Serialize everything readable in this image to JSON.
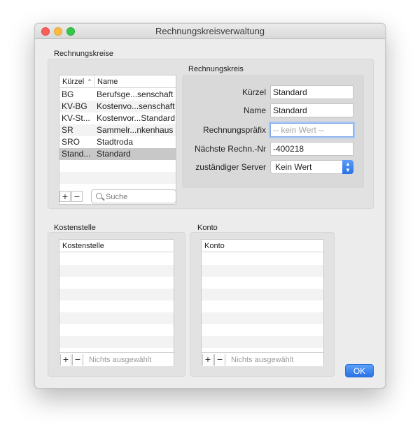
{
  "window": {
    "title": "Rechnungskreisverwaltung"
  },
  "rechnungskreise": {
    "section_label": "Rechnungskreise",
    "columns": [
      "Kürzel",
      "Name"
    ],
    "rows": [
      {
        "kuerzel": "BG",
        "name": "Berufsge...senschaft"
      },
      {
        "kuerzel": "KV-BG",
        "name": "Kostenvo...senschaft"
      },
      {
        "kuerzel": "KV-St...",
        "name": "Kostenvor...Standard"
      },
      {
        "kuerzel": "SR",
        "name": "Sammelr...nkenhaus"
      },
      {
        "kuerzel": "SRO",
        "name": "Stadtroda"
      },
      {
        "kuerzel": "Stand...",
        "name": "Standard"
      }
    ],
    "selected_row": "Standard",
    "add_label": "+",
    "remove_label": "−",
    "search_placeholder": "Suche"
  },
  "rechnungskreis": {
    "section_label": "Rechnungskreis",
    "kuerzel_label": "Kürzel",
    "kuerzel_value": "Standard",
    "name_label": "Name",
    "name_value": "Standard",
    "praefix_label": "Rechnungspräfix",
    "praefix_placeholder": "-- kein Wert --",
    "naechste_label": "Nächste Rechn.-Nr",
    "naechste_value": "-400218",
    "server_label": "zuständiger Server",
    "server_value": "Kein Wert"
  },
  "kostenstelle": {
    "section_label": "Kostenstelle",
    "column": "Kostenstelle",
    "add_label": "+",
    "remove_label": "−",
    "status": "Nichts ausgewählt"
  },
  "konto": {
    "section_label": "Konto",
    "column": "Konto",
    "add_label": "+",
    "remove_label": "−",
    "status": "Nichts ausgewählt"
  },
  "ok_label": "OK",
  "colors": {
    "accent": "#3a7ff0",
    "selected_row": "#c8c8c8"
  }
}
